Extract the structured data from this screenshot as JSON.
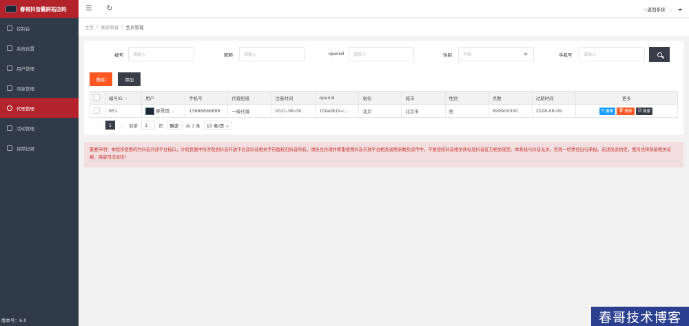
{
  "sidebar": {
    "brand": "春哥抖音霸屏拓店码",
    "items": [
      {
        "label": "控制台"
      },
      {
        "label": "系统设置"
      },
      {
        "label": "用户管理"
      },
      {
        "label": "商家管理"
      },
      {
        "label": "代理管理"
      },
      {
        "label": "活动管理"
      },
      {
        "label": "视频记录"
      }
    ],
    "active_index": 4,
    "version": "版本号：6.0"
  },
  "topbar": {
    "menu_icon": "menu-icon",
    "refresh_icon": "refresh-icon",
    "back_label": "返回系统",
    "back_icon": "chevron-left-icon",
    "theme_icon": "cloud-icon"
  },
  "breadcrumb": {
    "home": "主页",
    "sep": "/",
    "parent": "商家管理",
    "current": "会员管理"
  },
  "search": {
    "fields": [
      {
        "label": "编号",
        "placeholder": "请输入"
      },
      {
        "label": "昵称",
        "placeholder": "请输入"
      },
      {
        "label": "openid",
        "placeholder": "请输入"
      },
      {
        "label": "性别",
        "placeholder": "不限"
      },
      {
        "label": "手机号",
        "placeholder": "请输入"
      }
    ]
  },
  "toolbar": {
    "delete_label": "删除",
    "add_label": "添加"
  },
  "table": {
    "headers": [
      "编号ID",
      "用户",
      "手机号",
      "代理层级",
      "注册时间",
      "openid",
      "省份",
      "城市",
      "性别",
      "点数",
      "过期时间",
      "更多"
    ],
    "rows": [
      {
        "id": "851",
        "user": "春哥团...",
        "phone": "13888888888",
        "level": "一级代理",
        "reg_time": "2021-06-09 ...",
        "openid": "1fdad819-c...",
        "province": "北京",
        "city": "北京市",
        "gender": "男",
        "points": "999900000",
        "expire": "2028-06-09",
        "actions": {
          "edit": "编辑",
          "delete": "删除",
          "shop": "商家"
        }
      }
    ]
  },
  "pager": {
    "current": "1",
    "goto_label": "到第",
    "goto_value": "1",
    "page_unit": "页",
    "confirm": "确定",
    "total": "共 1 条",
    "page_size": "10 条/页"
  },
  "notice": "重要申明：本程序使用的为抖音开放平台接口，介绍页面中所涉及到抖音开放平台及抖音相关字符版权归抖音所有，请各位合理并尊重使用抖音开放平台相关调用参数及宣传中，不要侵权抖音相关商标及抖音官方相关规定。本系统与抖音无关。否则一切责任自行承担。若违反此约定，我司也将保留相关证据，保留司法途径！",
  "watermark": "春哥技术博客",
  "colors": {
    "accent": "#b3232b",
    "sidebar": "#2f3b48",
    "danger": "#ff5722",
    "dark": "#393d49",
    "info": "#1e9fff"
  }
}
